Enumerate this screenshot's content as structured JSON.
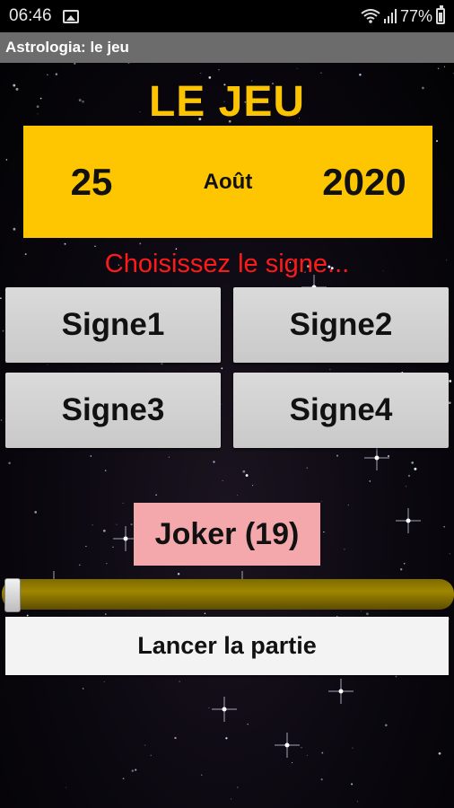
{
  "status_bar": {
    "time": "06:46",
    "battery": "77%"
  },
  "app_bar": {
    "title": "Astrologia: le jeu"
  },
  "game": {
    "title": "LE JEU",
    "date": {
      "day": "25",
      "month": "Août",
      "year": "2020"
    },
    "instruction": "Choisissez le signe...",
    "signs": [
      "Signe1",
      "Signe2",
      "Signe3",
      "Signe4"
    ],
    "joker_label": "Joker (19)",
    "slider_value": 0,
    "start_label": "Lancer la partie"
  },
  "colors": {
    "title": "#fcc400",
    "date_panel": "#fec600",
    "instruction": "#ff1a1a",
    "joker": "#f5a8ac",
    "slider_track": "#a08700"
  }
}
